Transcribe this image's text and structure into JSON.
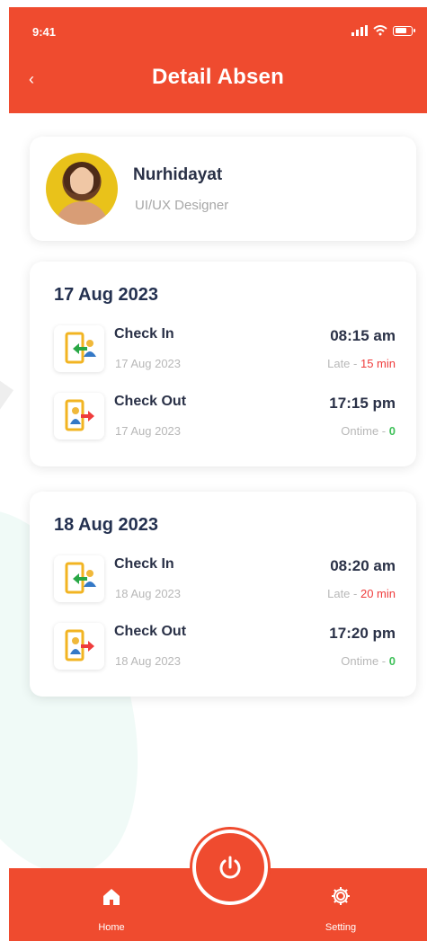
{
  "status_bar": {
    "time": "9:41"
  },
  "header": {
    "title": "Detail Absen",
    "back_icon": "chevron-left-icon"
  },
  "profile": {
    "name": "Nurhidayat",
    "role": "UI/UX Designer"
  },
  "records": [
    {
      "date": "17 Aug 2023",
      "check_in": {
        "label": "Check In",
        "date": "17 Aug 2023",
        "time": "08:15 am",
        "status_prefix": "Late - ",
        "status_value": "15 min"
      },
      "check_out": {
        "label": "Check Out",
        "date": "17 Aug 2023",
        "time": "17:15 pm",
        "status_prefix": "Ontime - ",
        "status_value": "0"
      }
    },
    {
      "date": "18 Aug 2023",
      "check_in": {
        "label": "Check In",
        "date": "18 Aug 2023",
        "time": "08:20 am",
        "status_prefix": "Late - ",
        "status_value": "20 min"
      },
      "check_out": {
        "label": "Check Out",
        "date": "18 Aug 2023",
        "time": "17:20 pm",
        "status_prefix": "Ontime - ",
        "status_value": "0"
      }
    }
  ],
  "bottom_nav": {
    "home_label": "Home",
    "setting_label": "Setting",
    "home_icon": "home-icon",
    "setting_icon": "gear-icon",
    "center_icon": "power-icon"
  },
  "colors": {
    "primary": "#ef4b2f",
    "late": "#ef3c3c",
    "ontime": "#40c15a"
  }
}
